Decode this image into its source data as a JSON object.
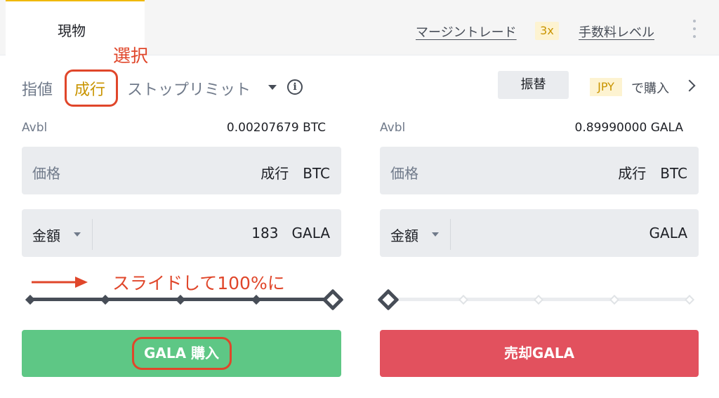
{
  "tabs": {
    "spot_label": "現物",
    "margin_label": "マージントレード",
    "leverage_badge": "3x",
    "fee_level_label": "手数料レベル"
  },
  "order_types": {
    "limit": "指値",
    "market": "成行",
    "stop_limit": "ストップリミット"
  },
  "actions": {
    "transfer_label": "振替",
    "currency_badge": "JPY",
    "buy_with_label": "で購入"
  },
  "annotations": {
    "select_label": "選択",
    "slide_label": "スライドして100%に"
  },
  "buy_panel": {
    "avbl_label": "Avbl",
    "avbl_value": "0.00207679 BTC",
    "price_label": "価格",
    "price_value": "成行　BTC",
    "amount_label": "金額",
    "amount_value": "183",
    "amount_unit": "GALA",
    "slider_percent": 100,
    "button_label": "GALA 購入"
  },
  "sell_panel": {
    "avbl_label": "Avbl",
    "avbl_value": "0.89990000 GALA",
    "price_label": "価格",
    "price_value": "成行　BTC",
    "amount_label": "金額",
    "amount_value": "",
    "amount_unit": "GALA",
    "slider_percent": 0,
    "button_label": "売却GALA"
  },
  "colors": {
    "accent": "#f0b90b",
    "buy": "#5ec785",
    "sell": "#e2515e",
    "annotation": "#e0462a"
  },
  "icons": [
    "info-icon",
    "chevron-right-icon",
    "kebab-menu-icon",
    "caret-down-icon",
    "arrow-right-icon"
  ]
}
